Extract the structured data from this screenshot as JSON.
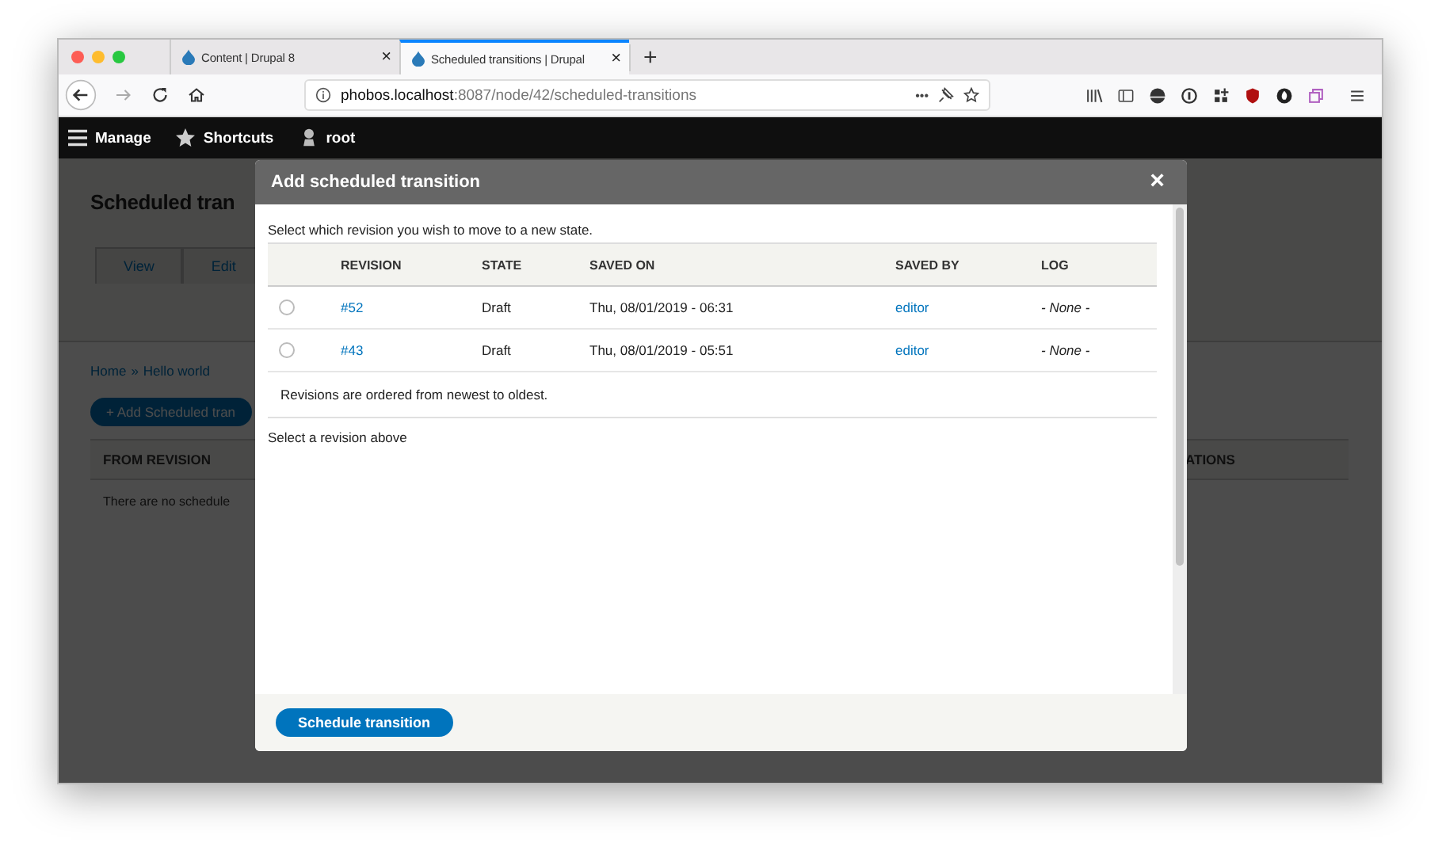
{
  "browser": {
    "tabs": [
      {
        "title": "Content | Drupal 8",
        "selected": false
      },
      {
        "title": "Scheduled transitions | Drupal",
        "selected": true
      }
    ],
    "close_glyph": "×",
    "new_tab": "+",
    "address_bar": {
      "host": "phobos.localhost",
      "path": ":8087/node/42/scheduled-transitions"
    },
    "page_actions": "•••"
  },
  "admin_toolbar": {
    "items": [
      {
        "label": "Manage",
        "kind": "menu"
      },
      {
        "label": "Shortcuts",
        "kind": "star"
      },
      {
        "label": "root",
        "kind": "user"
      }
    ]
  },
  "page": {
    "title": "Scheduled tran",
    "tabs": [
      "View",
      "Edit"
    ],
    "breadcrumb": {
      "items": [
        "Home",
        "Hello world"
      ],
      "separator": "»"
    },
    "add_button": "+ Add Scheduled tran",
    "table": {
      "columns": [
        "FROM REVISION",
        "ATIONS"
      ],
      "empty": "There are no schedule"
    }
  },
  "modal": {
    "title": "Add scheduled transition",
    "close": "×",
    "description": "Select which revision you wish to move to a new state.",
    "columns": [
      "REVISION",
      "STATE",
      "SAVED ON",
      "SAVED BY",
      "LOG"
    ],
    "rows": [
      {
        "selected": false,
        "revision": "#52",
        "state": "Draft",
        "saved_on": "Thu, 08/01/2019 - 06:31",
        "saved_by": "editor",
        "log": "- None -"
      },
      {
        "selected": false,
        "revision": "#43",
        "state": "Draft",
        "saved_on": "Thu, 08/01/2019 - 05:51",
        "saved_by": "editor",
        "log": "- None -"
      }
    ],
    "table_note": "Revisions are ordered from newest to oldest.",
    "status": "Select a revision above",
    "submit": "Schedule transition"
  }
}
